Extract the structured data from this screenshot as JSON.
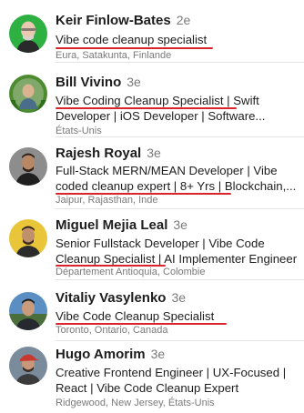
{
  "people": [
    {
      "name": "Keir Finlow-Bates",
      "degree": "2e",
      "headline": [
        "Vibe code cleanup specialist"
      ],
      "location": "Eura, Satakunta, Finlande",
      "avatar": "avatar-bald-man-green-bg-icon",
      "accent": "#2fb043"
    },
    {
      "name": "Bill Vivino",
      "degree": "3e",
      "headline": [
        "Vibe Coding Cleanup Specialist | Swift",
        "Developer | iOS Developer | Software..."
      ],
      "location": "États-Unis",
      "avatar": "avatar-opentowork-green-ring-icon",
      "accent": "#4c8b2f"
    },
    {
      "name": "Rajesh Royal",
      "degree": "3e",
      "headline": [
        "Full-Stack MERN/MEAN Developer | Vibe",
        "coded cleanup expert | 8+ Yrs | Blockchain,..."
      ],
      "location": "Jaipur, Rajasthan, Inde",
      "avatar": "avatar-man-grey-wall-icon",
      "accent": "#6f6f6f"
    },
    {
      "name": "Miguel Mejia Leal",
      "degree": "3e",
      "headline": [
        "Senior Fullstack Developer | Vibe Code",
        "Cleanup Specialist | AI Implementer Engineer"
      ],
      "location": "Département Antioquia, Colombie",
      "avatar": "avatar-man-yellow-bg-icon",
      "accent": "#e9c53a"
    },
    {
      "name": "Vitaliy Vasylenko",
      "degree": "3e",
      "headline": [
        "Vibe Code Cleanup Specialist"
      ],
      "location": "Toronto, Ontario, Canada",
      "avatar": "avatar-man-outdoor-blue-icon",
      "accent": "#5b8fc4"
    },
    {
      "name": "Hugo Amorim",
      "degree": "3e",
      "headline": [
        "Creative Frontend Engineer | UX-Focused |",
        "React | Vibe Code Cleanup Expert"
      ],
      "location": "Ridgewood, New Jersey, États-Unis",
      "avatar": "avatar-man-red-cap-icon",
      "accent": "#c8382f"
    }
  ],
  "colors": {
    "highlight_underline": "#d9242b",
    "text": "#1d1d1d",
    "muted": "#7a7a7a",
    "separator": "#e4e4e4"
  }
}
